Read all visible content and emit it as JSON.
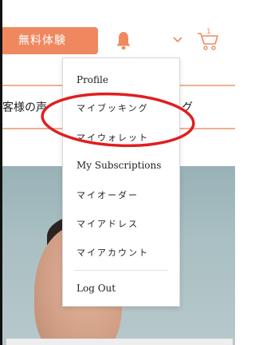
{
  "header": {
    "trial_button_label": "無料体験",
    "cart_count": "1",
    "icons": [
      "bell-icon",
      "chevron-down-icon",
      "cart-icon"
    ],
    "accent_color": "#f0885f"
  },
  "nav": {
    "left_fragment": "客様の声",
    "right_fragment": "グ"
  },
  "account_menu": {
    "items": [
      {
        "label": "Profile"
      },
      {
        "label": "マイブッキング"
      },
      {
        "label": "マイウォレット"
      },
      {
        "label": "My Subscriptions"
      },
      {
        "label": "マイオーダー"
      },
      {
        "label": "マイアドレス"
      },
      {
        "label": "マイアカウント"
      },
      {
        "label": "Log Out"
      }
    ]
  },
  "annotation": {
    "highlight_color": "#e01e1e"
  }
}
